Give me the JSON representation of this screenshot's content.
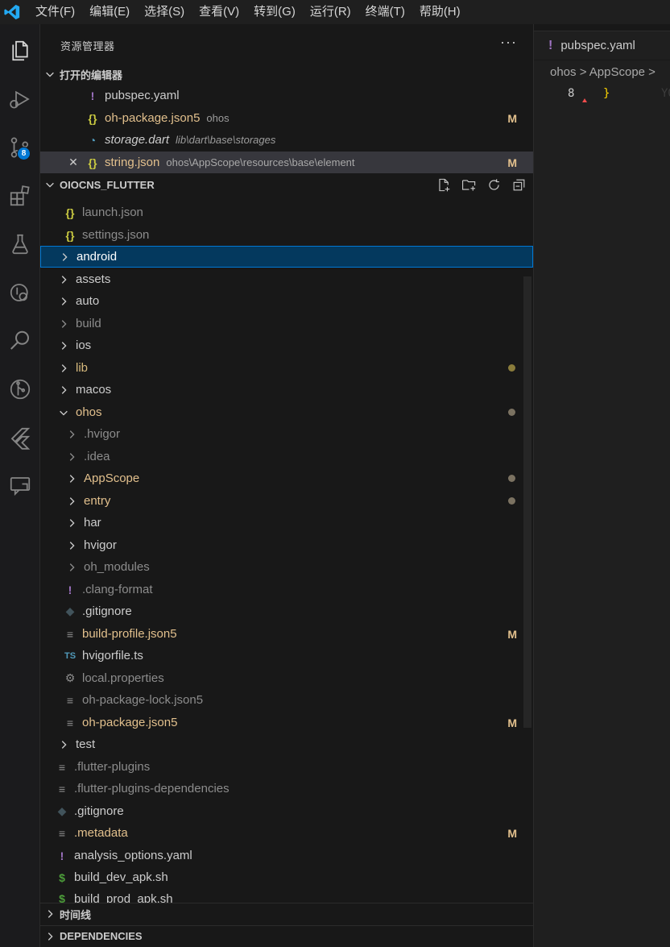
{
  "menubar": {
    "items": [
      "文件(F)",
      "编辑(E)",
      "选择(S)",
      "查看(V)",
      "转到(G)",
      "运行(R)",
      "终端(T)",
      "帮助(H)"
    ]
  },
  "activity": {
    "scm_badge": "8"
  },
  "explorer": {
    "title": "资源管理器",
    "more": "···",
    "open_editors": {
      "label": "打开的编辑器",
      "items": [
        {
          "icon": "!",
          "name": "pubspec.yaml",
          "desc": "",
          "status": ""
        },
        {
          "icon": "{}",
          "name": "oh-package.json5",
          "desc": "ohos",
          "status": "M"
        },
        {
          "icon": "◔",
          "name": "storage.dart",
          "desc": "lib\\dart\\base\\storages",
          "status": ""
        },
        {
          "icon": "{}",
          "name": "string.json",
          "desc": "ohos\\AppScope\\resources\\base\\element",
          "status": "M"
        }
      ]
    },
    "workspace": {
      "label": "OIOCNS_FLUTTER",
      "items": [
        {
          "icon": "{}",
          "name": "launch.json"
        },
        {
          "icon": "{}",
          "name": "settings.json"
        },
        {
          "name": "android"
        },
        {
          "name": "assets"
        },
        {
          "name": "auto"
        },
        {
          "name": "build"
        },
        {
          "name": "ios"
        },
        {
          "name": "lib"
        },
        {
          "name": "macos"
        },
        {
          "name": "ohos"
        },
        {
          "name": ".hvigor"
        },
        {
          "name": ".idea"
        },
        {
          "name": "AppScope"
        },
        {
          "name": "entry"
        },
        {
          "name": "har"
        },
        {
          "name": "hvigor"
        },
        {
          "name": "oh_modules"
        },
        {
          "icon": "!",
          "name": ".clang-format"
        },
        {
          "icon": "◆",
          "name": ".gitignore"
        },
        {
          "icon": "≡",
          "name": "build-profile.json5",
          "status": "M"
        },
        {
          "icon": "TS",
          "name": "hvigorfile.ts"
        },
        {
          "icon": "⚙",
          "name": "local.properties"
        },
        {
          "icon": "≡",
          "name": "oh-package-lock.json5"
        },
        {
          "icon": "≡",
          "name": "oh-package.json5",
          "status": "M"
        },
        {
          "name": "test"
        },
        {
          "icon": "≡",
          "name": ".flutter-plugins"
        },
        {
          "icon": "≡",
          "name": ".flutter-plugins-dependencies"
        },
        {
          "icon": "◆",
          "name": ".gitignore"
        },
        {
          "icon": "≡",
          "name": ".metadata",
          "status": "M"
        },
        {
          "icon": "!",
          "name": "analysis_options.yaml"
        },
        {
          "icon": "$",
          "name": "build_dev_apk.sh"
        },
        {
          "icon": "$",
          "name": "build_prod_apk.sh"
        }
      ]
    },
    "timeline": "时间线",
    "dependencies": "DEPENDENCIES"
  },
  "editor": {
    "tab_icon": "!",
    "tab_label": "pubspec.yaml",
    "breadcrumb": "ohos > AppScope >",
    "line_number": "8",
    "line_text": "}",
    "ghost_text": "YO"
  }
}
